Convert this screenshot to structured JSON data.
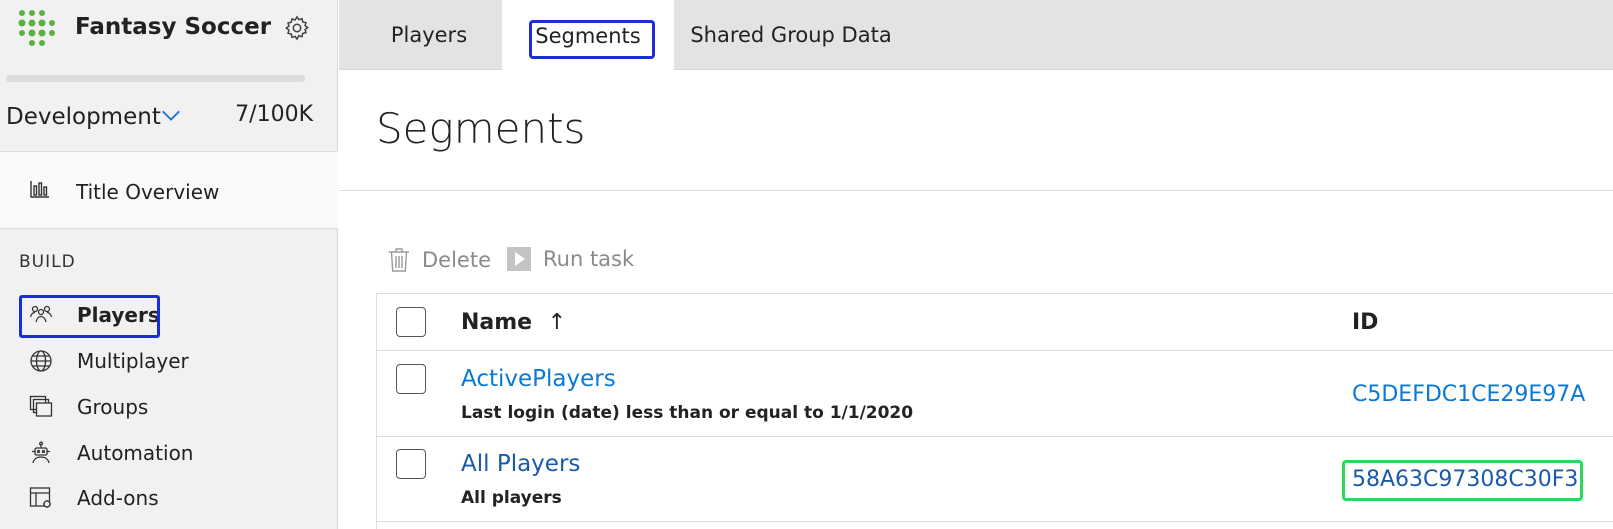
{
  "sidebar": {
    "title": "Fantasy Soccer",
    "environment": "Development",
    "usage": "7/100K",
    "overview_label": "Title Overview",
    "section_label": "BUILD",
    "items": [
      {
        "label": "Players",
        "icon": "players-icon",
        "active": true
      },
      {
        "label": "Multiplayer",
        "icon": "globe-icon"
      },
      {
        "label": "Groups",
        "icon": "groups-icon"
      },
      {
        "label": "Automation",
        "icon": "robot-icon"
      },
      {
        "label": "Add-ons",
        "icon": "addons-icon"
      }
    ]
  },
  "tabs": [
    {
      "label": "Players"
    },
    {
      "label": "Segments",
      "active": true
    },
    {
      "label": "Shared Group Data"
    }
  ],
  "page": {
    "title": "Segments"
  },
  "toolbar": {
    "delete_label": "Delete",
    "run_task_label": "Run task"
  },
  "table": {
    "headers": {
      "name": "Name",
      "sort_indicator": "↑",
      "id": "ID"
    },
    "rows": [
      {
        "name": "ActivePlayers",
        "description": "Last login (date) less than or equal to 1/1/2020",
        "id": "C5DEFDC1CE29E97A"
      },
      {
        "name": "All Players",
        "description": "All players",
        "id": "58A63C97308C30F3"
      }
    ]
  },
  "colors": {
    "accent_blue": "#0a78d6",
    "focus_outline": "#1a2ed6",
    "highlight_green": "#2fd65a",
    "logo_green": "#5bb042"
  }
}
